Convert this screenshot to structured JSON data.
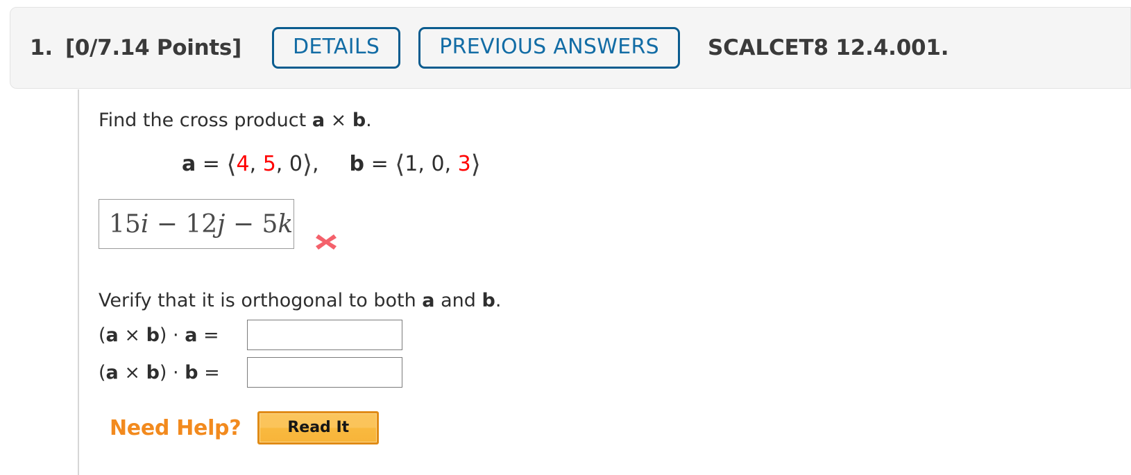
{
  "header": {
    "question_number": "1.",
    "points": "[0/7.14 Points]",
    "details_label": "DETAILS",
    "previous_answers_label": "PREVIOUS ANSWERS",
    "source": "SCALCET8 12.4.001.",
    "accent_color": "#0b5c8f",
    "background_color": "#f5f5f5"
  },
  "question": {
    "prompt_prefix": "Find the cross product ",
    "prompt_a": "a",
    "prompt_times": " × ",
    "prompt_b": "b",
    "prompt_suffix": ".",
    "vector_a": {
      "name": "a",
      "equals": " = ",
      "open": "⟨",
      "c1": "4",
      "sep1": ", ",
      "c2": "5",
      "sep2": ", ",
      "c3": "0",
      "close": "⟩",
      "trailing": ",",
      "highlight_color": "#ff0000"
    },
    "vector_b": {
      "name": "b",
      "equals": " = ",
      "open": "⟨",
      "c1": "1",
      "sep1": ", ",
      "c2": "0",
      "sep2": ", ",
      "c3": "3",
      "close": "⟩",
      "highlight_color": "#ff0000"
    }
  },
  "answer": {
    "value": "15i − 12j − 5k",
    "value_parts": {
      "n1": "15",
      "u1": "i",
      "op1": " − ",
      "n2": "12",
      "u2": "j",
      "op2": " − ",
      "n3": "5",
      "u3": "k"
    },
    "status_icon": "incorrect-x-icon",
    "status_color": "#f4616b"
  },
  "verify": {
    "instruction_prefix": "Verify that it is orthogonal to both ",
    "instruction_a": "a",
    "instruction_mid": " and ",
    "instruction_b": "b",
    "instruction_suffix": ".",
    "rows": [
      {
        "label_open": "(",
        "label_a": "a",
        "label_times": " × ",
        "label_b": "b",
        "label_close": ") · ",
        "label_operand": "a",
        "label_equals": " =",
        "value": "",
        "placeholder": ""
      },
      {
        "label_open": "(",
        "label_a": "a",
        "label_times": " × ",
        "label_b": "b",
        "label_close": ") · ",
        "label_operand": "b",
        "label_equals": " =",
        "value": "",
        "placeholder": ""
      }
    ]
  },
  "help": {
    "label": "Need Help?",
    "label_color": "#f28a1e",
    "button_label": "Read It",
    "button_color": "#fbc45a"
  }
}
